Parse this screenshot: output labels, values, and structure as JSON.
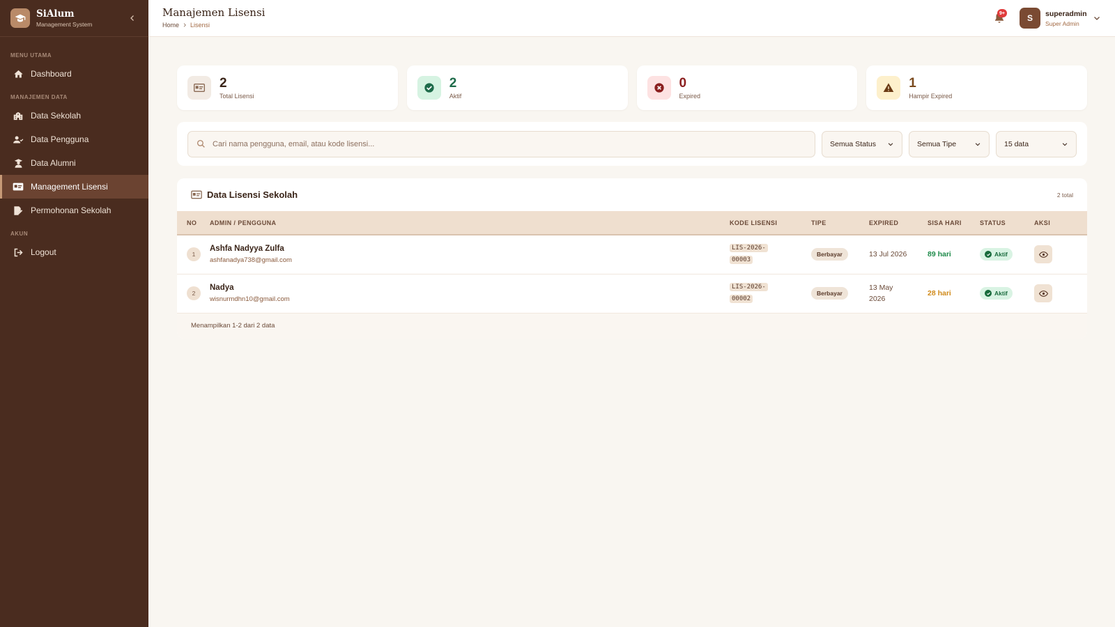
{
  "brand": {
    "name": "SiAlum",
    "subtitle": "Management System"
  },
  "sidebar": {
    "sections": [
      {
        "label": "MENU UTAMA",
        "items": [
          {
            "label": "Dashboard",
            "icon": "home-icon"
          }
        ]
      },
      {
        "label": "MANAJEMEN DATA",
        "items": [
          {
            "label": "Data Sekolah",
            "icon": "school-icon"
          },
          {
            "label": "Data Pengguna",
            "icon": "users-icon"
          },
          {
            "label": "Data Alumni",
            "icon": "graduate-icon"
          },
          {
            "label": "Management Lisensi",
            "icon": "id-card-icon",
            "active": true
          },
          {
            "label": "Permohonan Sekolah",
            "icon": "file-signature-icon"
          }
        ]
      },
      {
        "label": "AKUN",
        "items": [
          {
            "label": "Logout",
            "icon": "logout-icon"
          }
        ]
      }
    ]
  },
  "header": {
    "title": "Manajemen Lisensi",
    "breadcrumb": {
      "home": "Home",
      "current": "Lisensi"
    },
    "notification_badge": "9+",
    "user": {
      "initial": "S",
      "name": "superadmin",
      "role": "Super Admin"
    }
  },
  "stats": [
    {
      "value": "2",
      "label": "Total Lisensi",
      "color": "#3a2418",
      "icon_bg": "#f2ebe4",
      "icon": "id-card-icon"
    },
    {
      "value": "2",
      "label": "Aktif",
      "color": "#1e6b4a",
      "icon_bg": "#d6f3e2",
      "icon": "check-circle-icon"
    },
    {
      "value": "0",
      "label": "Expired",
      "color": "#8b1f1f",
      "icon_bg": "#fde2e2",
      "icon": "x-circle-icon"
    },
    {
      "value": "1",
      "label": "Hampir Expired",
      "color": "#7a4a1e",
      "icon_bg": "#fdf0cc",
      "icon": "warning-icon"
    }
  ],
  "filters": {
    "search_placeholder": "Cari nama pengguna, email, atau kode lisensi...",
    "status": "Semua Status",
    "tipe": "Semua Tipe",
    "per_page": "15 data"
  },
  "table": {
    "title": "Data Lisensi Sekolah",
    "total": "2 total",
    "columns": [
      "NO",
      "ADMIN / PENGGUNA",
      "KODE LISENSI",
      "TIPE",
      "EXPIRED",
      "SISA HARI",
      "STATUS",
      "AKSI"
    ],
    "rows": [
      {
        "no": "1",
        "name": "Ashfa Nadyya Zulfa",
        "email": "ashfanadya738@gmail.com",
        "code_1": "LIS-2026-",
        "code_2": "00003",
        "tipe": "Berbayar",
        "expired_1": "13 Jul 2026",
        "expired_2": "",
        "sisa": "89 hari",
        "sisa_color": "#1e8a4a",
        "status": "Aktif"
      },
      {
        "no": "2",
        "name": "Nadya",
        "email": "wisnurmdhn10@gmail.com",
        "code_1": "LIS-2026-",
        "code_2": "00002",
        "tipe": "Berbayar",
        "expired_1": "13 May",
        "expired_2": "2026",
        "sisa": "28 hari",
        "sisa_color": "#d08a1a",
        "status": "Aktif"
      }
    ],
    "footer": "Menampilkan 1-2 dari 2 data"
  }
}
